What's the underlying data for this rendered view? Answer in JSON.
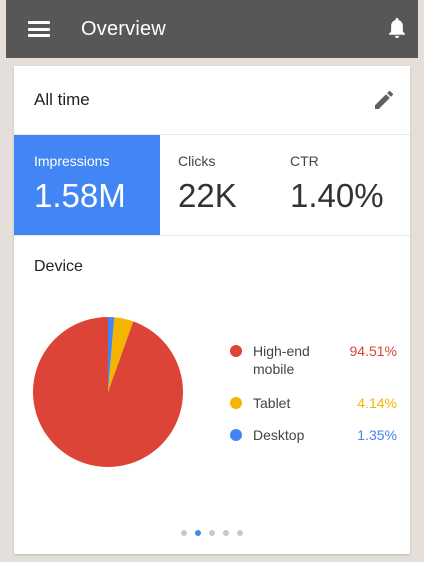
{
  "appbar": {
    "title": "Overview",
    "menu_icon": "hamburger-menu-icon",
    "notification_icon": "bell-icon"
  },
  "card": {
    "period_label": "All time",
    "edit_icon": "pencil-icon"
  },
  "metrics": [
    {
      "label": "Impressions",
      "value": "1.58M",
      "selected": true
    },
    {
      "label": "Clicks",
      "value": "22K",
      "selected": false
    },
    {
      "label": "CTR",
      "value": "1.40%",
      "selected": false
    }
  ],
  "device": {
    "title": "Device",
    "legend": [
      {
        "label": "High-end mobile",
        "value": "94.51%",
        "color": "#db4437"
      },
      {
        "label": "Tablet",
        "value": "4.14%",
        "color": "#f4b400"
      },
      {
        "label": "Desktop",
        "value": "1.35%",
        "color": "#4285f4"
      }
    ]
  },
  "colors": {
    "accent": "#4285f4",
    "appbar": "#575757"
  },
  "pager": {
    "count": 5,
    "active_index": 1
  },
  "chart_data": {
    "type": "pie",
    "categories": [
      "High-end mobile",
      "Tablet",
      "Desktop"
    ],
    "values": [
      94.51,
      4.14,
      1.35
    ],
    "colors": [
      "#db4437",
      "#f4b400",
      "#4285f4"
    ],
    "title": "Device"
  }
}
